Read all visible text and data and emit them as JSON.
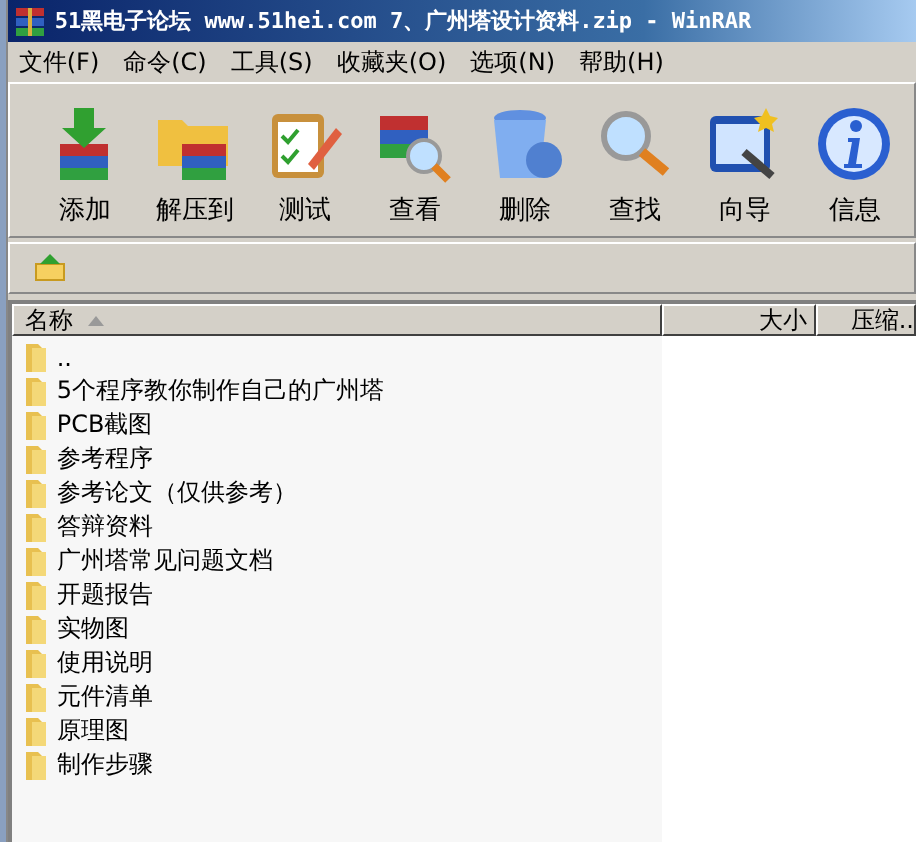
{
  "window": {
    "title": "51黑电子论坛 www.51hei.com 7、广州塔设计资料.zip - WinRAR"
  },
  "menu": [
    "文件(F)",
    "命令(C)",
    "工具(S)",
    "收藏夹(O)",
    "选项(N)",
    "帮助(H)"
  ],
  "toolbar": [
    {
      "label": "添加"
    },
    {
      "label": "解压到"
    },
    {
      "label": "测试"
    },
    {
      "label": "查看"
    },
    {
      "label": "删除"
    },
    {
      "label": "查找"
    },
    {
      "label": "向导"
    },
    {
      "label": "信息"
    }
  ],
  "file_list": {
    "columns": [
      "名称",
      "大小",
      "压缩.."
    ],
    "rows": [
      "..",
      "5个程序教你制作自己的广州塔",
      "PCB截图",
      "参考程序",
      "参考论文（仅供参考）",
      "答辩资料",
      "广州塔常见问题文档",
      "开题报告",
      "实物图",
      "使用说明",
      "元件清单",
      "原理图",
      "制作步骤"
    ]
  }
}
